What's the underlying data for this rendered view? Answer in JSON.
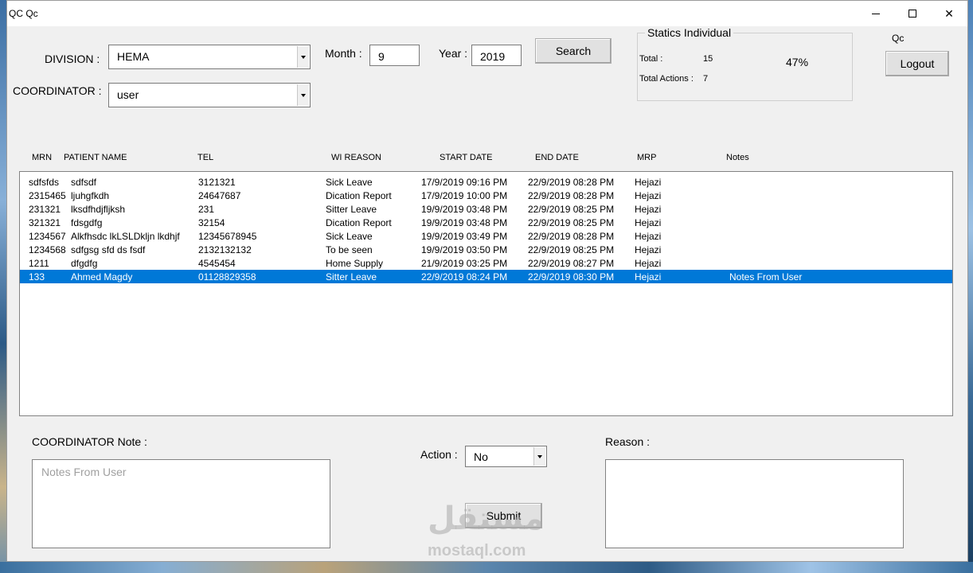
{
  "window": {
    "title": "QC Qc"
  },
  "form": {
    "division_label": "DIVISION :",
    "division_value": "HEMA",
    "coordinator_label": "COORDINATOR :",
    "coordinator_value": "user",
    "month_label": "Month :",
    "month_value": "9",
    "year_label": "Year :",
    "year_value": "2019",
    "search_label": "Search"
  },
  "stats": {
    "title": "Statics Individual",
    "total_label": "Total :",
    "total_value": "15",
    "actions_label": "Total Actions :",
    "actions_value": "7",
    "percent": "47%"
  },
  "user": {
    "name": "Qc",
    "logout_label": "Logout"
  },
  "table": {
    "columns": [
      "MRN",
      "PATIENT NAME",
      "TEL",
      "WI REASON",
      "START DATE",
      "END DATE",
      "MRP",
      "Notes"
    ],
    "rows": [
      [
        "sdfsfds",
        "sdfsdf",
        "3121321",
        "Sick Leave",
        "17/9/2019 09:16 PM",
        "22/9/2019 08:28 PM",
        "Hejazi",
        ""
      ],
      [
        "2315465",
        "ljuhgfkdh",
        "24647687",
        "Dication Report",
        "17/9/2019 10:00 PM",
        "22/9/2019 08:28 PM",
        "Hejazi",
        ""
      ],
      [
        "231321",
        "lksdfhdjfljksh",
        "231",
        "Sitter Leave",
        "19/9/2019 03:48 PM",
        "22/9/2019 08:25 PM",
        "Hejazi",
        ""
      ],
      [
        "321321",
        "fdsgdfg",
        "32154",
        "Dication Report",
        "19/9/2019 03:48 PM",
        "22/9/2019 08:25 PM",
        "Hejazi",
        ""
      ],
      [
        "1234567",
        "Alkfhsdc lkLSLDkljn lkdhjf",
        "12345678945",
        "Sick Leave",
        "19/9/2019 03:49 PM",
        "22/9/2019 08:28 PM",
        "Hejazi",
        ""
      ],
      [
        "1234568",
        "sdfgsg sfd ds fsdf",
        "2132132132",
        "To be seen",
        "19/9/2019 03:50 PM",
        "22/9/2019 08:25 PM",
        "Hejazi",
        ""
      ],
      [
        "1211",
        "dfgdfg",
        "4545454",
        "Home Supply",
        "21/9/2019 03:25 PM",
        "22/9/2019 08:27 PM",
        "Hejazi",
        ""
      ],
      [
        "133",
        "Ahmed Magdy",
        "01128829358",
        "Sitter Leave",
        "22/9/2019 08:24 PM",
        "22/9/2019 08:30 PM",
        "Hejazi",
        "Notes From User"
      ]
    ],
    "selected_row": 7
  },
  "bottom": {
    "note_label": "COORDINATOR Note :",
    "note_value": "Notes From User",
    "action_label": "Action :",
    "action_value": "No",
    "reason_label": "Reason :",
    "submit_label": "Submit"
  },
  "watermark": {
    "arabic": "مستقل",
    "latin": "mostaql.com"
  }
}
